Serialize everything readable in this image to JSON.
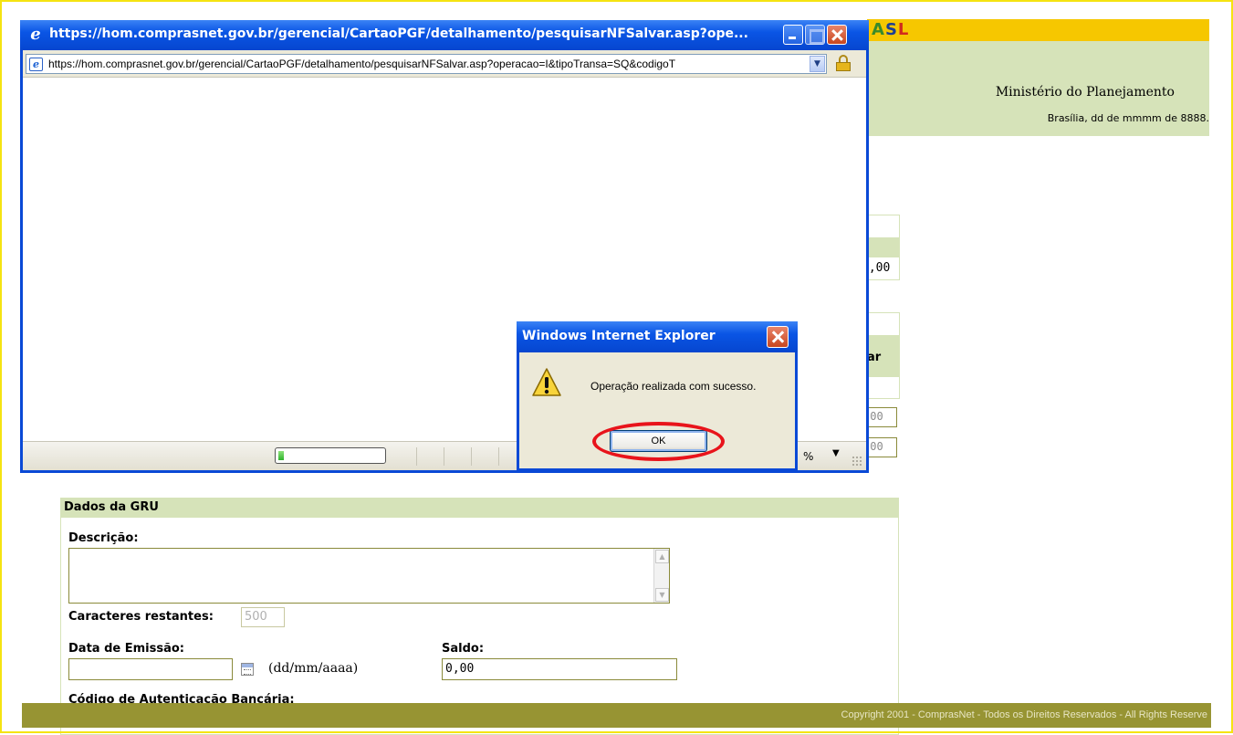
{
  "background": {
    "logo": {
      "text_a": "A",
      "text_s": "S",
      "text_l": "L"
    },
    "ministry": "Ministério do Planejamento",
    "date_line": "Brasília, dd de mmmm de 8888.",
    "fragments": {
      "value_a": "),00",
      "col_fragment": "ar",
      "value_b": ",00",
      "value_c": ",00",
      "zoom_fragment": "%"
    },
    "gru": {
      "header": "Dados da GRU",
      "descricao_label": "Descrição:",
      "descricao_value": "",
      "caracteres_label": "Caracteres restantes:",
      "caracteres_value": "500",
      "data_label": "Data de Emissão:",
      "data_value": "",
      "date_format_hint": "(dd/mm/aaaa)",
      "saldo_label": "Saldo:",
      "saldo_value": "0,00",
      "codigo_label": "Código de Autenticação Bancária:"
    },
    "footer": "Copyright 2001 - ComprasNet - Todos os Direitos Reservados - All Rights Reserve"
  },
  "popup": {
    "title": "https://hom.comprasnet.gov.br/gerencial/CartaoPGF/detalhamento/pesquisarNFSalvar.asp?ope...",
    "address": "https://hom.comprasnet.gov.br/gerencial/CartaoPGF/detalhamento/pesquisarNFSalvar.asp?operacao=I&tipoTransa=SQ&codigoT",
    "progress": 0.05,
    "icons": [
      "ie-icon",
      "minimize-icon",
      "maximize-icon",
      "close-icon",
      "lock-icon",
      "resize-grip-icon"
    ]
  },
  "dialog": {
    "title": "Windows Internet Explorer",
    "message": "Operação realizada com sucesso.",
    "ok_label": "OK",
    "icon": "warning-icon",
    "highlight_color": "#e8141b"
  },
  "colors": {
    "xp_blue": "#0a49d6",
    "page_green": "#d6e3b9",
    "footer_olive": "#979433",
    "banner_yellow": "#f6c700"
  }
}
